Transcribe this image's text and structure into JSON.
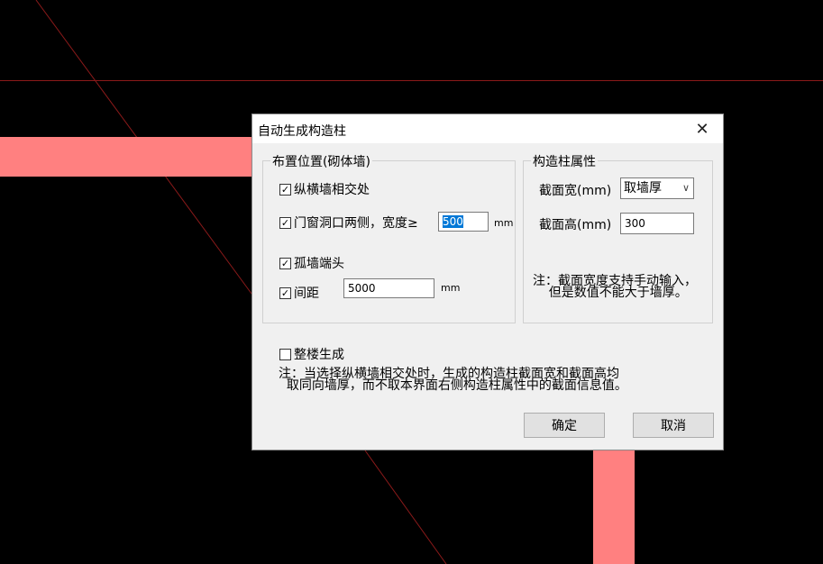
{
  "dialog": {
    "title": "自动生成构造柱",
    "close_glyph": "✕",
    "placement_group": {
      "title": "布置位置(砌体墙)",
      "opt_cross": {
        "label": "纵横墙相交处",
        "checked": true
      },
      "opt_opening": {
        "label": "门窗洞口两侧，宽度≥",
        "checked": true,
        "value": "500",
        "unit": "mm"
      },
      "opt_end": {
        "label": "孤墙端头",
        "checked": true
      },
      "opt_spacing": {
        "label": "间距",
        "checked": true,
        "value": "5000",
        "unit": "mm"
      }
    },
    "props_group": {
      "title": "构造柱属性",
      "width_label": "截面宽(mm)",
      "width_value": "取墙厚",
      "height_label": "截面高(mm)",
      "height_value": "300",
      "note": "注：截面宽度支持手动输入，\n    但是数值不能大于墙厚。"
    },
    "whole_building": {
      "label": "整楼生成",
      "checked": false
    },
    "bottom_note": "注：当选择纵横墙相交处时，生成的构造柱截面宽和截面高均\n  取同向墙厚，而不取本界面右侧构造柱属性中的截面信息值。",
    "ok_label": "确定",
    "cancel_label": "取消",
    "check_glyph": "✓"
  }
}
